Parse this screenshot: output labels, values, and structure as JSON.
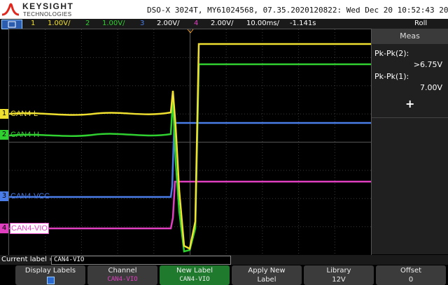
{
  "header": {
    "brand": "KEYSIGHT",
    "brand_sub": "TECHNOLOGIES",
    "info": "DSO-X 3024T, MY61024568, 07.35.2020120822: Wed Dec 20 10:52:43 2023"
  },
  "statusbar": {
    "channels": [
      {
        "num": "1",
        "scale": "1.00V/",
        "color": "#f0e030"
      },
      {
        "num": "2",
        "scale": "1.00V/",
        "color": "#30d030"
      },
      {
        "num": "3",
        "scale": "2.00V/",
        "color": "#4a7de8"
      },
      {
        "num": "4",
        "scale": "2.00V/",
        "color": "#e040c0"
      }
    ],
    "timebase": "10.00ms/",
    "delay": "-1.141s",
    "mode": "Roll",
    "trigger_flag": "f"
  },
  "waveform_labels": [
    {
      "text": "CAN4-L",
      "color": "#f0e030",
      "marker": "1"
    },
    {
      "text": "CAN4-H",
      "color": "#30d030",
      "marker": "2"
    },
    {
      "text": "CAN4-VCC",
      "color": "#4a7de8",
      "marker": "3"
    },
    {
      "text": "CAN4-VIO",
      "color": "#e040c0",
      "marker": "4"
    }
  ],
  "meas": {
    "title": "Meas",
    "items": [
      {
        "label": "Pk-Pk(2):",
        "value": ">6.75V",
        "channel_color": "#30d030"
      },
      {
        "label": "Pk-Pk(1):",
        "value": "7.00V",
        "channel_color": "#f0e030"
      }
    ],
    "add_icon": "+"
  },
  "current_label": {
    "prefix": "Current label =",
    "value": "CAN4-VIO"
  },
  "softkeys": [
    {
      "line1": "Display Labels",
      "line2": "",
      "icon": "checkbox-icon"
    },
    {
      "line1": "Channel",
      "line2": "CAN4-VIO",
      "line2_color": "#e040c0"
    },
    {
      "line1": "New Label",
      "line2": "CAN4-VIO"
    },
    {
      "line1": "Apply New",
      "line2": "Label"
    },
    {
      "line1": "Library",
      "line2": "12V"
    },
    {
      "line1": "Offset",
      "line2": "0"
    }
  ]
}
